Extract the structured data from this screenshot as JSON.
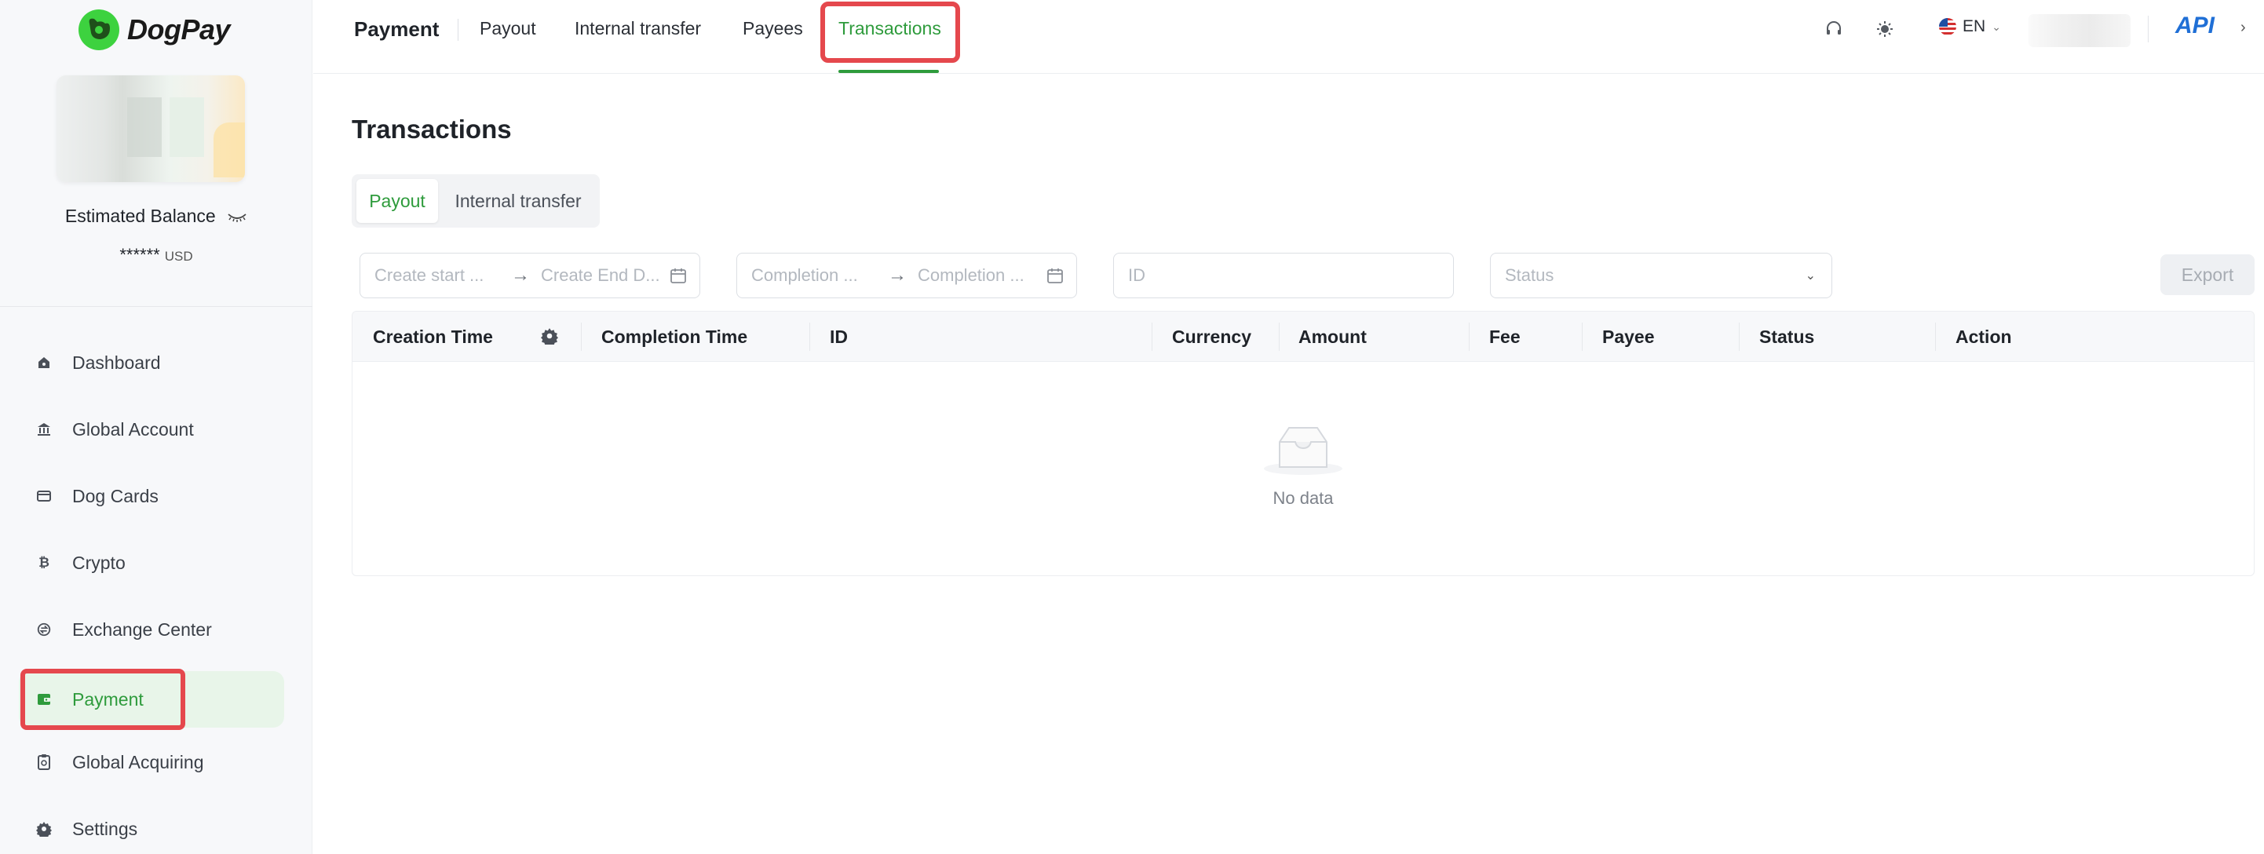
{
  "brand": {
    "name": "DogPay"
  },
  "sidebar": {
    "balance_label": "Estimated Balance",
    "balance_value": "******",
    "balance_currency": "USD",
    "items": [
      {
        "label": "Dashboard",
        "icon": "dashboard-icon"
      },
      {
        "label": "Global Account",
        "icon": "bank-icon"
      },
      {
        "label": "Dog Cards",
        "icon": "card-icon"
      },
      {
        "label": "Crypto",
        "icon": "bitcoin-icon"
      },
      {
        "label": "Exchange Center",
        "icon": "exchange-icon"
      },
      {
        "label": "Payment",
        "icon": "wallet-icon",
        "active": true
      },
      {
        "label": "Global Acquiring",
        "icon": "acquiring-icon"
      },
      {
        "label": "Settings",
        "icon": "gear-icon"
      }
    ]
  },
  "topbar": {
    "section": "Payment",
    "tabs": [
      "Payout",
      "Internal transfer",
      "Payees",
      "Transactions"
    ],
    "active_tab": "Transactions",
    "language": "EN",
    "api_label": "API"
  },
  "main": {
    "title": "Transactions",
    "segments": [
      "Payout",
      "Internal transfer"
    ],
    "active_segment": "Payout",
    "filters": {
      "create_start": "Create start ...",
      "create_end": "Create End D...",
      "completion_start": "Completion ...",
      "completion_end": "Completion ...",
      "id": "ID",
      "status": "Status"
    },
    "export_label": "Export",
    "columns": [
      "Creation Time",
      "Completion Time",
      "ID",
      "Currency",
      "Amount",
      "Fee",
      "Payee",
      "Status",
      "Action"
    ],
    "rows": [],
    "empty_text": "No data"
  },
  "colors": {
    "accent": "#2e9b3c",
    "highlight": "#e5484d",
    "api": "#1f6fd6",
    "brand": "#3dd23f"
  }
}
